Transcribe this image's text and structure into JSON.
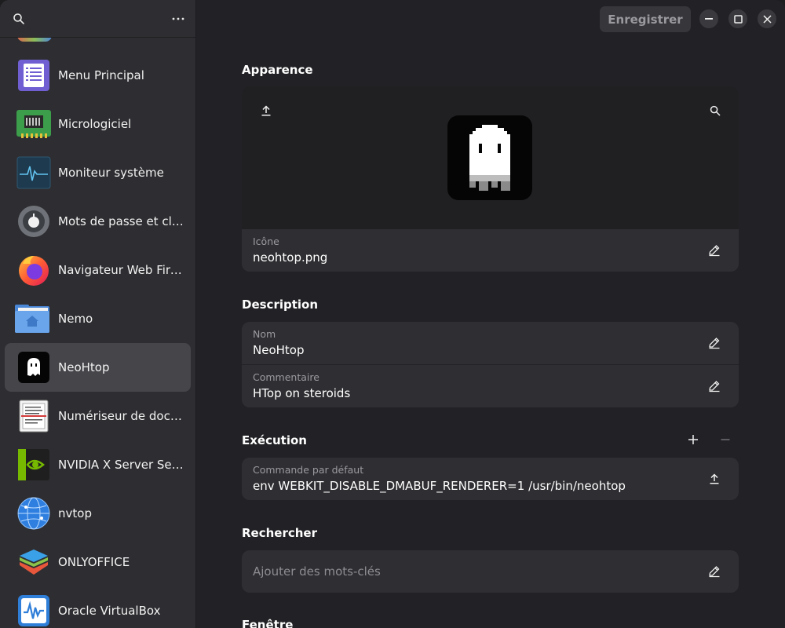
{
  "sidebar": {
    "items": [
      {
        "label": "Menu Principal",
        "icon": "menu-principal-icon"
      },
      {
        "label": "Micrologiciel",
        "icon": "firmware-chip-icon"
      },
      {
        "label": "Moniteur système",
        "icon": "system-monitor-icon"
      },
      {
        "label": "Mots de passe et clés",
        "icon": "passwords-keys-icon"
      },
      {
        "label": "Navigateur Web Fire…",
        "icon": "firefox-icon"
      },
      {
        "label": "Nemo",
        "icon": "nemo-folder-icon"
      },
      {
        "label": "NeoHtop",
        "icon": "neohtop-ghost-icon",
        "selected": true
      },
      {
        "label": "Numériseur de docu…",
        "icon": "document-scanner-icon"
      },
      {
        "label": "NVIDIA X Server Sett…",
        "icon": "nvidia-icon"
      },
      {
        "label": "nvtop",
        "icon": "nvtop-globe-icon"
      },
      {
        "label": "ONLYOFFICE",
        "icon": "onlyoffice-icon"
      },
      {
        "label": "Oracle VirtualBox",
        "icon": "virtualbox-icon"
      }
    ]
  },
  "header": {
    "save_label": "Enregistrer"
  },
  "appearance": {
    "title": "Apparence",
    "icon_sub": "Icône",
    "icon_value": "neohtop.png"
  },
  "description": {
    "title": "Description",
    "name_sub": "Nom",
    "name_value": "NeoHtop",
    "comment_sub": "Commentaire",
    "comment_value": "HTop on steroids"
  },
  "execution": {
    "title": "Exécution",
    "command_sub": "Commande par défaut",
    "command_value": "env WEBKIT_DISABLE_DMABUF_RENDERER=1 /usr/bin/neohtop"
  },
  "search": {
    "title": "Rechercher",
    "placeholder": "Ajouter des mots-clés"
  },
  "window_section": {
    "title": "Fenêtre"
  },
  "colors": {
    "accent_selected": "#45454a",
    "background": "#222226",
    "card": "#2f2f33"
  }
}
